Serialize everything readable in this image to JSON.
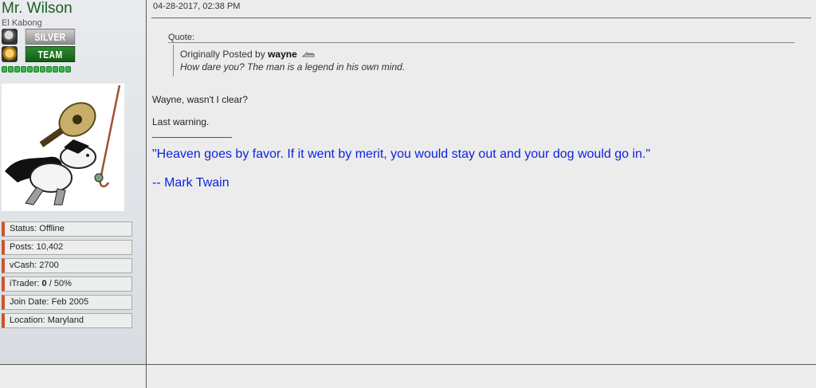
{
  "user": {
    "name": "Mr. Wilson",
    "title": "El Kabong",
    "ranks": [
      {
        "label": "SILVER",
        "icon": "silver-rank-icon"
      },
      {
        "label": "TEAM",
        "icon": "team-rank-icon"
      }
    ],
    "reputation_dots": 11,
    "avatar": "el-kabong-avatar",
    "info": {
      "status": "Status: Offline",
      "posts": "Posts: 10,402",
      "vcash": "vCash: 2700",
      "itrader_prefix": "iTrader: ",
      "itrader_count": "0",
      "itrader_suffix": " / 50%",
      "join_date": "Join Date: Feb 2005",
      "location": "Location: Maryland"
    }
  },
  "post": {
    "date": "04-28-2017, 02:38 PM",
    "quote": {
      "label": "Quote:",
      "posted_by_prefix": "Originally Posted by ",
      "author": "wayne",
      "text": "How dare you? The man is a legend in his own mind."
    },
    "body": [
      "Wayne, wasn't I clear?",
      "Last warning."
    ],
    "signature": {
      "quote": "\"Heaven goes by favor. If it went by merit, you would stay out and your dog would go in.\"",
      "attribution": "-- Mark Twain"
    }
  },
  "colors": {
    "username": "#1b5e20",
    "signature": "#0d23e0",
    "info_accent": "#c8572a"
  }
}
